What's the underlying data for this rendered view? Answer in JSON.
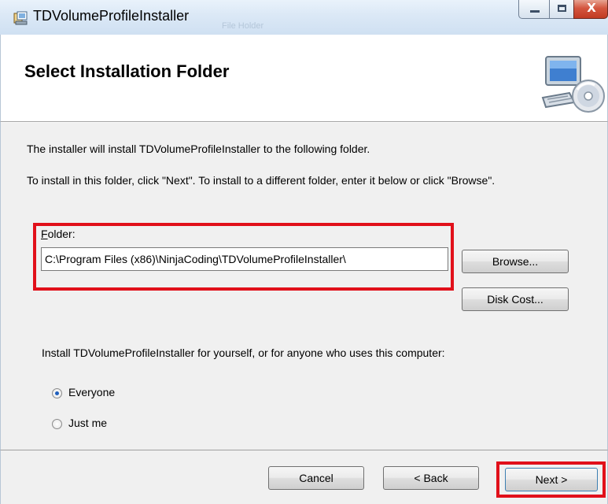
{
  "window": {
    "title": "TDVolumeProfileInstaller",
    "ghost_tabs": [
      "",
      "File Holder"
    ],
    "close_glyph": "X"
  },
  "banner": {
    "title": "Select Installation Folder",
    "icon": "computer-disc-icon"
  },
  "body": {
    "line1": "The installer will install TDVolumeProfileInstaller to the following folder.",
    "line2": "To install in this folder, click \"Next\". To install to a different folder, enter it below or click \"Browse\".",
    "folder_label_first": "F",
    "folder_label_rest": "older:",
    "folder_value": "C:\\Program Files (x86)\\NinjaCoding\\TDVolumeProfileInstaller\\",
    "browse_label": "Browse...",
    "disk_cost_label": "Disk Cost...",
    "install_for": "Install TDVolumeProfileInstaller for yourself, or for anyone who uses this computer:",
    "radio_options": [
      {
        "label": "Everyone",
        "selected": true
      },
      {
        "label": "Just me",
        "selected": false
      }
    ]
  },
  "footer": {
    "cancel_label": "Cancel",
    "back_label": "< Back",
    "next_label": "Next >"
  },
  "annotation_color": "#e1101a"
}
